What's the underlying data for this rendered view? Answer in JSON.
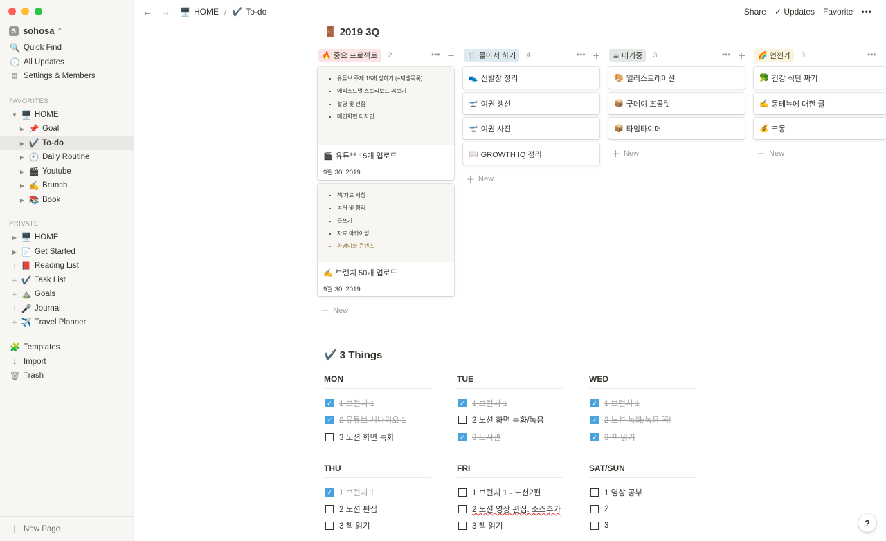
{
  "workspace": {
    "badge": "S",
    "name": "sohosa"
  },
  "sidebar_nav": [
    {
      "icon": "🔍",
      "label": "Quick Find"
    },
    {
      "icon": "🕘",
      "label": "All Updates"
    },
    {
      "icon": "⚙",
      "label": "Settings & Members"
    }
  ],
  "favorites_title": "FAVORITES",
  "favorites": [
    {
      "emoji": "🖥️",
      "label": "HOME"
    },
    {
      "emoji": "📌",
      "label": "Goal"
    },
    {
      "emoji": "✔️",
      "label": "To-do"
    },
    {
      "emoji": "🕘",
      "label": "Daily Routine"
    },
    {
      "emoji": "🎬",
      "label": "Youtube"
    },
    {
      "emoji": "✍️",
      "label": "Brunch"
    },
    {
      "emoji": "📚",
      "label": "Book"
    }
  ],
  "private_title": "PRIVATE",
  "private": [
    {
      "emoji": "🖥️",
      "label": "HOME"
    },
    {
      "emoji": "📄",
      "label": "Get Started"
    },
    {
      "emoji": "📕",
      "label": "Reading List"
    },
    {
      "emoji": "✔️",
      "label": "Task List"
    },
    {
      "emoji": "⛰️",
      "label": "Goals"
    },
    {
      "emoji": "🎤",
      "label": "Journal"
    },
    {
      "emoji": "✈️",
      "label": "Travel Planner"
    }
  ],
  "sidebar_bottom": [
    {
      "icon": "🧩",
      "label": "Templates"
    },
    {
      "icon": "⤓",
      "label": "Import"
    },
    {
      "icon": "🗑",
      "label": "Trash"
    }
  ],
  "new_page": "New Page",
  "breadcrumb": {
    "home_emoji": "🖥️",
    "home": "HOME",
    "sep": "/",
    "cur_emoji": "✔️",
    "cur": "To-do"
  },
  "top_actions": {
    "share": "Share",
    "updates": "Updates",
    "favorite": "Favorite",
    "more": "•••"
  },
  "board_title": {
    "emoji": "🚪",
    "text": "2019 3Q"
  },
  "columns": [
    {
      "emoji": "🔥",
      "name": "중요 프로젝트",
      "count": "2",
      "color": "#fbe4e4"
    },
    {
      "emoji": "🍴",
      "name": "몰아서 하기",
      "count": "4",
      "color": "#ddebf1"
    },
    {
      "emoji": "☕",
      "name": "대기중",
      "count": "3",
      "color": "#e2e8e4"
    },
    {
      "emoji": "🌈",
      "name": "언젠가",
      "count": "3",
      "color": "#fbf3db"
    }
  ],
  "col1_cards": [
    {
      "bullets": [
        "유튜브 주제 15개 정하기 (+재생목록)",
        "에피소드별 스토리보드 써보기",
        "촬영 및 편집",
        "메인화면 디자인"
      ],
      "emoji": "🎬",
      "title": "유튜브 15개 업로드",
      "date": "9월 30, 2019"
    },
    {
      "bullets": [
        "책/자료 서칭",
        "독서 및 정리",
        "글쓰기",
        "자료 아카이빙",
        "환경미화 콘텐츠"
      ],
      "emoji": "✍️",
      "title": "브런치 50개 업로드",
      "date": "9월 30, 2019"
    }
  ],
  "col2_cards": [
    {
      "emoji": "👟",
      "title": "신발장 정리"
    },
    {
      "emoji": "🛫",
      "title": "여권 갱신"
    },
    {
      "emoji": "🛫",
      "title": "여권 사진"
    },
    {
      "emoji": "📖",
      "title": "GROWTH IQ 정리"
    }
  ],
  "col3_cards": [
    {
      "emoji": "🎨",
      "title": "일러스트레이션"
    },
    {
      "emoji": "📦",
      "title": "굿데이 초콜릿"
    },
    {
      "emoji": "📦",
      "title": "타임타이머"
    }
  ],
  "col4_cards": [
    {
      "emoji": "🥦",
      "title": "건강 식단 짜기"
    },
    {
      "emoji": "✍️",
      "title": "몽테뉴에 대한 글"
    },
    {
      "emoji": "💰",
      "title": "크몽"
    }
  ],
  "new_label": "New",
  "things_title": {
    "emoji": "✔️",
    "text": "3 Things"
  },
  "days": [
    {
      "name": "MON",
      "items": [
        {
          "text": "1 브런치 1",
          "done": true
        },
        {
          "text": "2 유튜브 시나리오 1",
          "done": true
        },
        {
          "text": "3 노션 화면 녹화",
          "done": false
        }
      ]
    },
    {
      "name": "TUE",
      "items": [
        {
          "text": "1 브런치 1",
          "done": true
        },
        {
          "text": "2 노션 화면 녹화/녹음",
          "done": false
        },
        {
          "text": "3 도서관",
          "done": true
        }
      ]
    },
    {
      "name": "WED",
      "items": [
        {
          "text": "1 브런치 1",
          "done": true
        },
        {
          "text": "2 노션 녹화/녹음 꼭!",
          "done": true
        },
        {
          "text": "3 책 읽기",
          "done": true
        }
      ]
    },
    {
      "name": "THU",
      "items": [
        {
          "text": "1 브런치 1",
          "done": true
        },
        {
          "text": "2 노션 편집",
          "done": false
        },
        {
          "text": "3 책 읽기",
          "done": false
        }
      ]
    },
    {
      "name": "FRI",
      "items": [
        {
          "text": "1 브런치 1 - 노션2편",
          "done": false
        },
        {
          "text": "2 노션 영상 편집. 소스추가",
          "done": false
        },
        {
          "text": "3 책 읽기",
          "done": false
        }
      ]
    },
    {
      "name": "SAT/SUN",
      "items": [
        {
          "text": "1 영상 공부",
          "done": false
        },
        {
          "text": "2",
          "done": false
        },
        {
          "text": "3",
          "done": false
        }
      ]
    }
  ],
  "help": "?"
}
